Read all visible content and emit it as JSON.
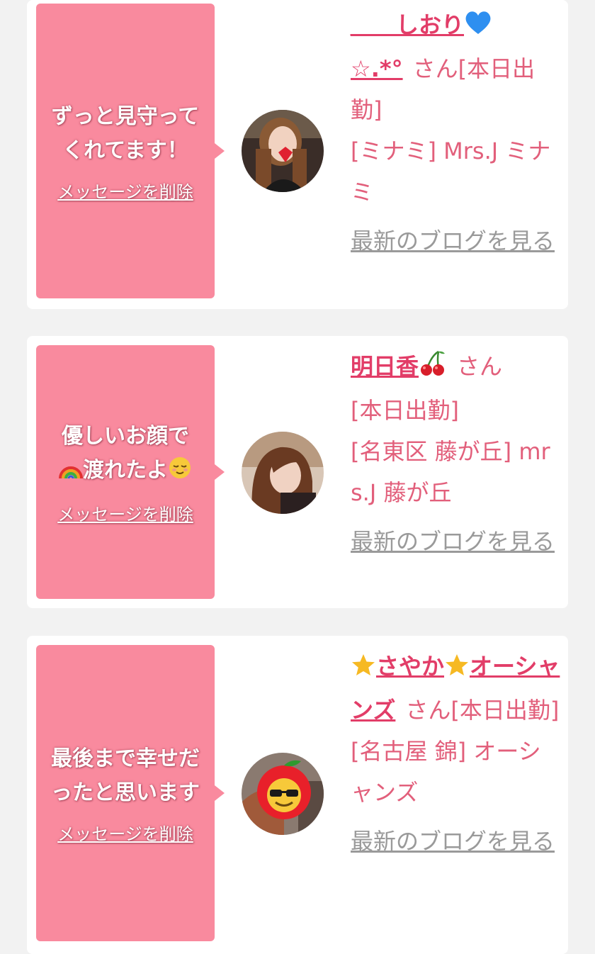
{
  "colors": {
    "bubble": "#f98a9e",
    "name": "#e23d68",
    "text": "#e25f7b",
    "link_grey": "#9a9a9a"
  },
  "cards": [
    {
      "message_line1": "ずっと見守って",
      "message_line2": "くれてます！",
      "delete_label": "メッセージを削除",
      "name_part1": "＿＿しおり",
      "name_icon": "blue-heart-icon",
      "name_part2": "☆.*°",
      "san": "さん",
      "status": "[本日出勤]",
      "shop": "[ミナミ] Mrs.J ミナミ",
      "blog_label": "最新のブログを見る"
    },
    {
      "message_line1": "優しいお顔で",
      "message_line2": "渡れたよ",
      "message_icon_before": "rainbow-icon",
      "message_icon_after": "relieved-face-icon",
      "delete_label": "メッセージを削除",
      "name_part1": "明日香",
      "name_icon": "cherries-icon",
      "san": "さん",
      "status": "[本日出勤]",
      "shop": "[名東区 藤が丘] mrs.J 藤が丘",
      "blog_label": "最新のブログを見る"
    },
    {
      "message_line1": "最後まで幸せだ",
      "message_line2": "ったと思います",
      "delete_label": "メッセージを削除",
      "name_icon_before": "star-icon",
      "name_part1": "さやか",
      "name_icon": "star-icon",
      "name_part2": "オーシャンズ",
      "san": "さん",
      "status": "[本日出勤]",
      "shop": "[名古屋 錦] オーシャンズ",
      "blog_label": "最新のブログを見る"
    }
  ]
}
